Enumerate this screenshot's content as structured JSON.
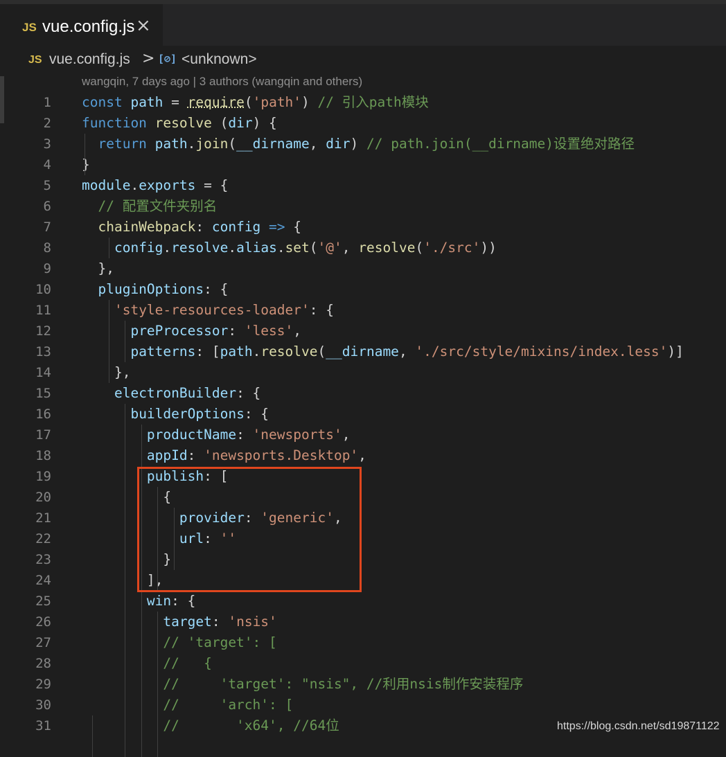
{
  "tab": {
    "icon": "JS",
    "filename": "vue.config.js",
    "close": "×"
  },
  "breadcrumb": {
    "icon": "JS",
    "file": "vue.config.js",
    "separator": ">",
    "symbol_icon": "[⊘]",
    "symbol": "<unknown>"
  },
  "blame": "wangqin, 7 days ago | 3 authors (wangqin and others)",
  "watermark": "https://blog.csdn.net/sd19871122",
  "highlight_color": "#e0461e",
  "lines": [
    {
      "n": "1",
      "parts": [
        [
          "k",
          "const "
        ],
        [
          "v",
          "path"
        ],
        [
          "p",
          " = "
        ],
        [
          "u",
          "require"
        ],
        [
          "p",
          "("
        ],
        [
          "s",
          "'path'"
        ],
        [
          "p",
          ") "
        ],
        [
          "c",
          "// 引入path模块"
        ]
      ]
    },
    {
      "n": "2",
      "parts": [
        [
          "k",
          "function "
        ],
        [
          "f",
          "resolve"
        ],
        [
          "p",
          " ("
        ],
        [
          "v",
          "dir"
        ],
        [
          "p",
          ") {"
        ]
      ]
    },
    {
      "n": "3",
      "parts": [
        [
          "k",
          "  return "
        ],
        [
          "v",
          "path"
        ],
        [
          "p",
          "."
        ],
        [
          "f",
          "join"
        ],
        [
          "p",
          "("
        ],
        [
          "v",
          "__dirname"
        ],
        [
          "p",
          ", "
        ],
        [
          "v",
          "dir"
        ],
        [
          "p",
          ") "
        ],
        [
          "c",
          "// path.join(__dirname)设置绝对路径"
        ]
      ]
    },
    {
      "n": "4",
      "parts": [
        [
          "p",
          "}"
        ]
      ]
    },
    {
      "n": "5",
      "parts": [
        [
          "v",
          "module"
        ],
        [
          "p",
          "."
        ],
        [
          "v",
          "exports"
        ],
        [
          "p",
          " = {"
        ]
      ]
    },
    {
      "n": "6",
      "parts": [
        [
          "c",
          "  // 配置文件夹别名"
        ]
      ]
    },
    {
      "n": "7",
      "parts": [
        [
          "p",
          "  "
        ],
        [
          "f",
          "chainWebpack"
        ],
        [
          "p",
          ": "
        ],
        [
          "v",
          "config"
        ],
        [
          "k",
          " =>"
        ],
        [
          "p",
          " {"
        ]
      ]
    },
    {
      "n": "8",
      "parts": [
        [
          "p",
          "    "
        ],
        [
          "v",
          "config"
        ],
        [
          "p",
          "."
        ],
        [
          "v",
          "resolve"
        ],
        [
          "p",
          "."
        ],
        [
          "v",
          "alias"
        ],
        [
          "p",
          "."
        ],
        [
          "f",
          "set"
        ],
        [
          "p",
          "("
        ],
        [
          "s",
          "'@'"
        ],
        [
          "p",
          ", "
        ],
        [
          "f",
          "resolve"
        ],
        [
          "p",
          "("
        ],
        [
          "s",
          "'./src'"
        ],
        [
          "p",
          "))"
        ]
      ]
    },
    {
      "n": "9",
      "parts": [
        [
          "p",
          "  },"
        ]
      ]
    },
    {
      "n": "10",
      "parts": [
        [
          "p",
          "  "
        ],
        [
          "v",
          "pluginOptions"
        ],
        [
          "p",
          ": {"
        ]
      ]
    },
    {
      "n": "11",
      "parts": [
        [
          "p",
          "    "
        ],
        [
          "s",
          "'style-resources-loader'"
        ],
        [
          "p",
          ": {"
        ]
      ]
    },
    {
      "n": "12",
      "parts": [
        [
          "p",
          "      "
        ],
        [
          "v",
          "preProcessor"
        ],
        [
          "p",
          ": "
        ],
        [
          "s",
          "'less'"
        ],
        [
          "p",
          ","
        ]
      ]
    },
    {
      "n": "13",
      "parts": [
        [
          "p",
          "      "
        ],
        [
          "v",
          "patterns"
        ],
        [
          "p",
          ": ["
        ],
        [
          "v",
          "path"
        ],
        [
          "p",
          "."
        ],
        [
          "f",
          "resolve"
        ],
        [
          "p",
          "("
        ],
        [
          "v",
          "__dirname"
        ],
        [
          "p",
          ", "
        ],
        [
          "s",
          "'./src/style/mixins/index.less'"
        ],
        [
          "p",
          ")]"
        ]
      ]
    },
    {
      "n": "14",
      "parts": [
        [
          "p",
          "    },"
        ]
      ]
    },
    {
      "n": "15",
      "parts": [
        [
          "p",
          "    "
        ],
        [
          "v",
          "electronBuilder"
        ],
        [
          "p",
          ": {"
        ]
      ]
    },
    {
      "n": "16",
      "parts": [
        [
          "p",
          "      "
        ],
        [
          "v",
          "builderOptions"
        ],
        [
          "p",
          ": {"
        ]
      ]
    },
    {
      "n": "17",
      "parts": [
        [
          "p",
          "        "
        ],
        [
          "v",
          "productName"
        ],
        [
          "p",
          ": "
        ],
        [
          "s",
          "'newsports'"
        ],
        [
          "p",
          ","
        ]
      ]
    },
    {
      "n": "18",
      "parts": [
        [
          "p",
          "        "
        ],
        [
          "v",
          "appId"
        ],
        [
          "p",
          ": "
        ],
        [
          "s",
          "'newsports.Desktop'"
        ],
        [
          "p",
          ","
        ]
      ]
    },
    {
      "n": "19",
      "parts": [
        [
          "p",
          "        "
        ],
        [
          "v",
          "publish"
        ],
        [
          "p",
          ": ["
        ]
      ]
    },
    {
      "n": "20",
      "parts": [
        [
          "p",
          "          {"
        ]
      ]
    },
    {
      "n": "21",
      "parts": [
        [
          "p",
          "            "
        ],
        [
          "v",
          "provider"
        ],
        [
          "p",
          ": "
        ],
        [
          "s",
          "'generic'"
        ],
        [
          "p",
          ","
        ]
      ]
    },
    {
      "n": "22",
      "parts": [
        [
          "p",
          "            "
        ],
        [
          "v",
          "url"
        ],
        [
          "p",
          ": "
        ],
        [
          "s",
          "''"
        ]
      ]
    },
    {
      "n": "23",
      "parts": [
        [
          "p",
          "          }"
        ]
      ]
    },
    {
      "n": "24",
      "parts": [
        [
          "p",
          "        ],"
        ]
      ]
    },
    {
      "n": "25",
      "parts": [
        [
          "p",
          "        "
        ],
        [
          "v",
          "win"
        ],
        [
          "p",
          ": {"
        ]
      ]
    },
    {
      "n": "26",
      "parts": [
        [
          "p",
          "          "
        ],
        [
          "v",
          "target"
        ],
        [
          "p",
          ": "
        ],
        [
          "s",
          "'nsis'"
        ]
      ]
    },
    {
      "n": "27",
      "parts": [
        [
          "c",
          "          // 'target': ["
        ]
      ]
    },
    {
      "n": "28",
      "parts": [
        [
          "c",
          "          //   {"
        ]
      ]
    },
    {
      "n": "29",
      "parts": [
        [
          "c",
          "          //     'target': \"nsis\", //利用nsis制作安装程序"
        ]
      ]
    },
    {
      "n": "30",
      "parts": [
        [
          "c",
          "          //     'arch': ["
        ]
      ]
    },
    {
      "n": "31",
      "parts": [
        [
          "c",
          "          //       'x64', //64位"
        ]
      ]
    }
  ]
}
